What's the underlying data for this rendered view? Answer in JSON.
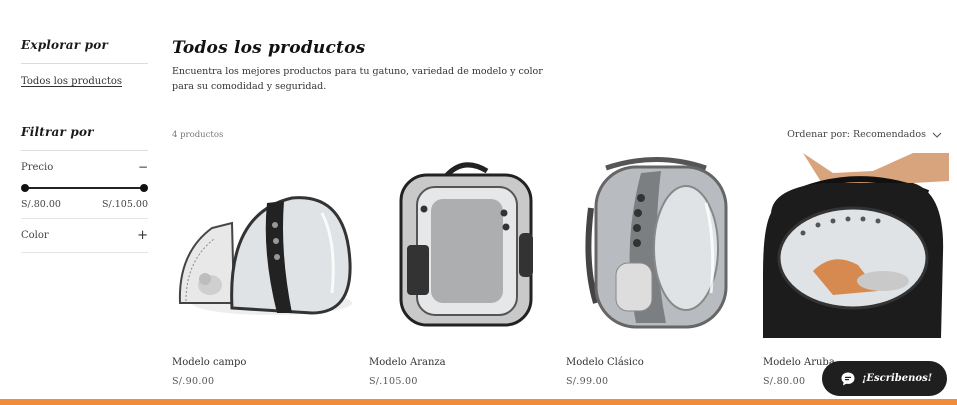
{
  "sidebar": {
    "explore_heading": "Explorar por",
    "all_products_link": "Todos los productos",
    "filter_heading": "Filtrar por",
    "price": {
      "label": "Precio",
      "toggle": "−",
      "min": "S/.80.00",
      "max": "S/.105.00"
    },
    "color": {
      "label": "Color",
      "toggle": "+"
    }
  },
  "main": {
    "title": "Todos los productos",
    "description": "Encuentra los mejores productos para tu gatuno, variedad de modelo y color para su comodidad y seguridad.",
    "count": "4 productos",
    "sort_label": "Ordenar por: Recomendados"
  },
  "products": [
    {
      "name": "Modelo campo",
      "price": "S/.90.00"
    },
    {
      "name": "Modelo Aranza",
      "price": "S/.105.00"
    },
    {
      "name": "Modelo Clásico",
      "price": "S/.99.00"
    },
    {
      "name": "Modelo Aruba",
      "price": "S/.80.00"
    }
  ],
  "chat": {
    "label": "¡Escribenos!"
  },
  "colors": {
    "accent_bar": "#f08c3a",
    "chat_bg": "#1f1f1f"
  }
}
